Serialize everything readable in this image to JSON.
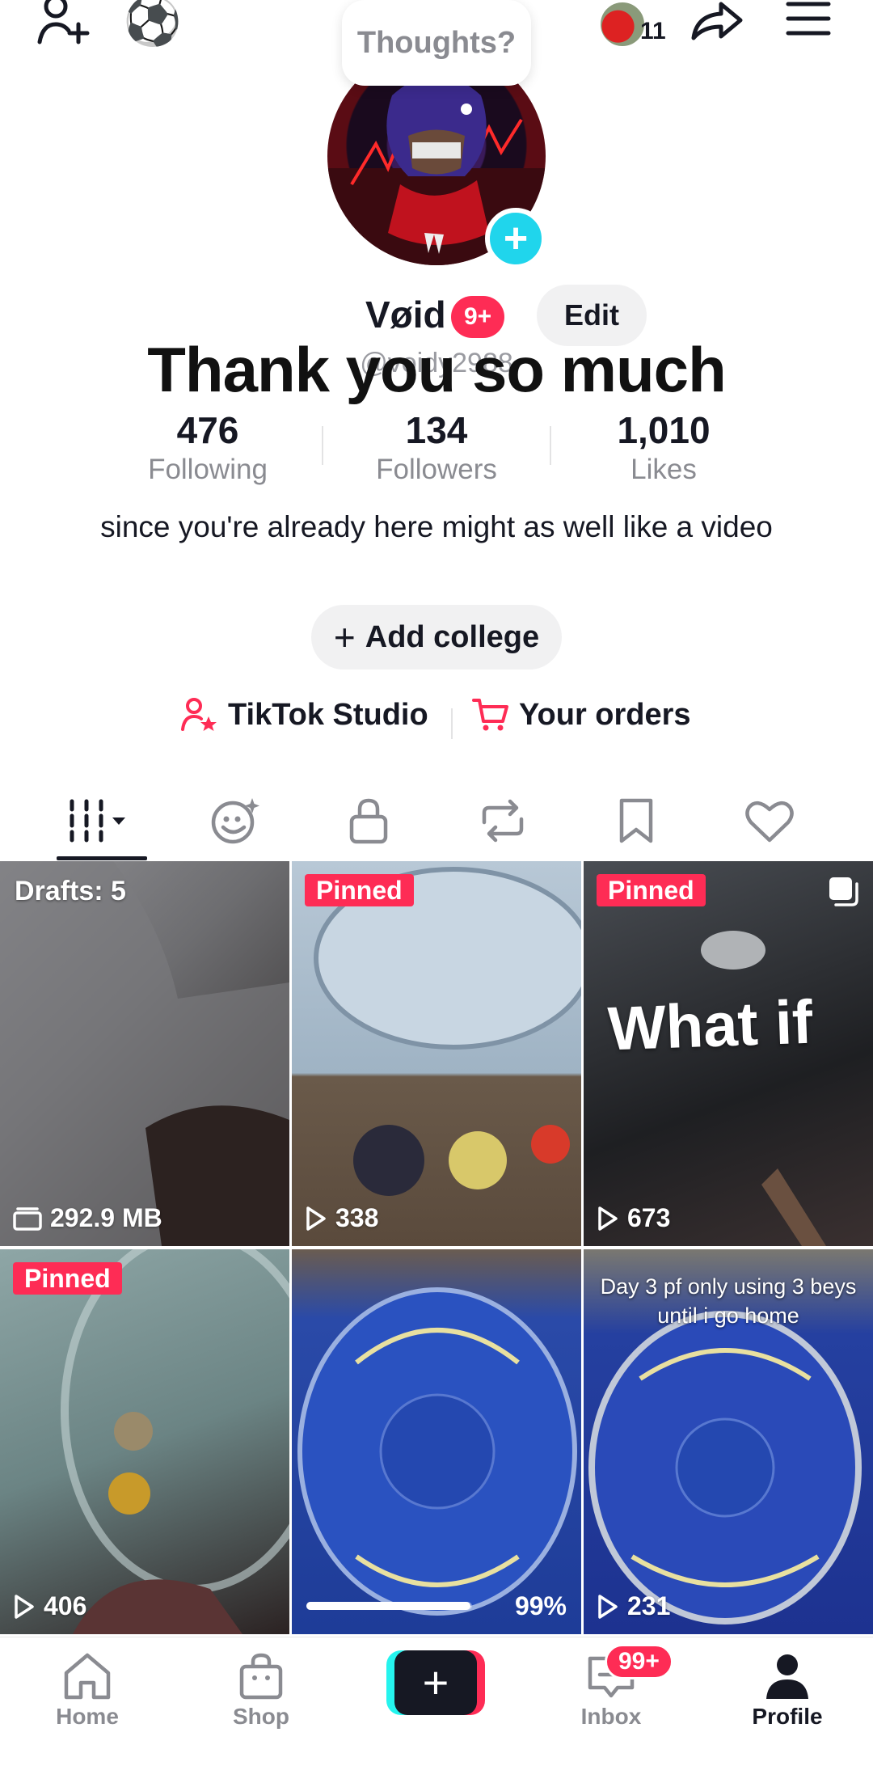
{
  "header": {
    "thought_bubble": "Thoughts?",
    "friends_count": "11"
  },
  "profile": {
    "name": "Vøid",
    "name_badge": "9+",
    "edit_label": "Edit",
    "handle": "@voidy2988",
    "overlay_text": "Thank you so much",
    "bio": "since you're already  here  might as well like a video",
    "add_college_label": "Add college"
  },
  "stats": [
    {
      "value": "476",
      "label": "Following"
    },
    {
      "value": "134",
      "label": "Followers"
    },
    {
      "value": "1,010",
      "label": "Likes"
    }
  ],
  "links": {
    "studio": "TikTok Studio",
    "orders": "Your orders"
  },
  "tabs": [
    "videos",
    "reposts-ai",
    "private",
    "reposts",
    "saved",
    "liked"
  ],
  "grid": {
    "drafts_label": "Drafts: 5",
    "drafts_size": "292.9 MB",
    "pinned_label": "Pinned",
    "videos": [
      {
        "views": "338"
      },
      {
        "views": "673",
        "caption": "What if"
      },
      {
        "views": "406"
      },
      {
        "progress_label": "99%",
        "progress": 0.99
      },
      {
        "views": "231",
        "caption": "Day 3 pf only using 3 beys until i  go home"
      }
    ]
  },
  "nav": {
    "home": "Home",
    "shop": "Shop",
    "inbox": "Inbox",
    "inbox_badge": "99+",
    "profile": "Profile"
  },
  "colors": {
    "accent_red": "#fe2c55",
    "accent_cyan": "#20d5ec",
    "text_primary": "#161823",
    "text_secondary": "#8a8b91"
  }
}
